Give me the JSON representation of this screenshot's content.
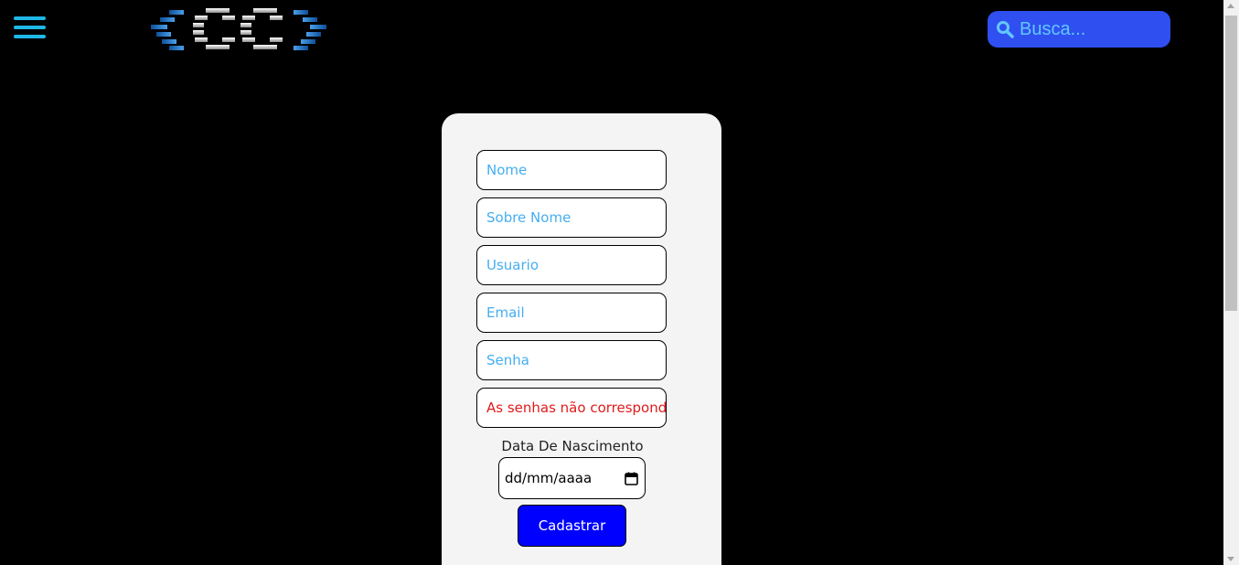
{
  "header": {
    "menu_icon": "hamburger-menu-icon",
    "logo_icon": "code-brackets-logo",
    "search": {
      "placeholder": "Busca...",
      "icon": "search-icon"
    }
  },
  "form": {
    "fields": [
      {
        "name": "nome",
        "placeholder": "Nome"
      },
      {
        "name": "sobre-nome",
        "placeholder": "Sobre Nome"
      },
      {
        "name": "usuario",
        "placeholder": "Usuario"
      },
      {
        "name": "email",
        "placeholder": "Email"
      },
      {
        "name": "senha",
        "placeholder": "Senha"
      }
    ],
    "password_error": "As senhas não correspondem",
    "dob_label": "Data De Nascimento",
    "dob_value": "dd/mm/aaaa",
    "submit_label": "Cadastrar"
  },
  "colors": {
    "background": "#000000",
    "accent_cyan": "#1fb7e8",
    "search_bg": "#2f4ff0",
    "placeholder_blue": "#45aef0",
    "error_red": "#e01b1b",
    "button_blue": "#0000ff",
    "card_bg": "#f4f4f4"
  }
}
